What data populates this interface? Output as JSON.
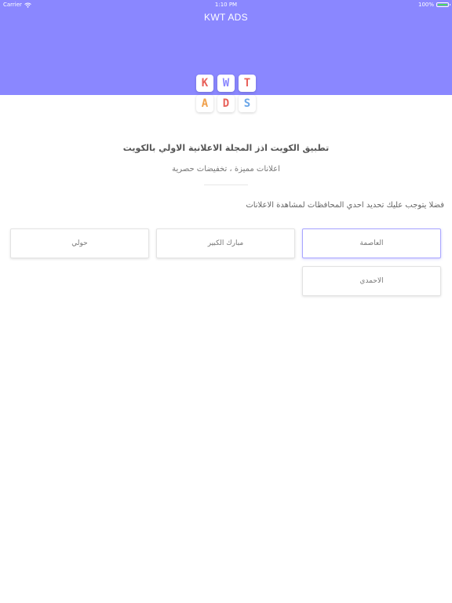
{
  "status_bar": {
    "carrier": "Carrier",
    "time": "1:10 PM",
    "battery": "100%",
    "battery_level": 1.0
  },
  "header": {
    "title": "KWT ADS",
    "color": "#8a87ff"
  },
  "logo": {
    "row1": [
      {
        "letter": "K",
        "color": "#e8615a"
      },
      {
        "letter": "W",
        "color": "#8a87ff"
      },
      {
        "letter": "T",
        "color": "#e8615a"
      }
    ],
    "row2": [
      {
        "letter": "A",
        "color": "#f0a04b"
      },
      {
        "letter": "D",
        "color": "#e8615a"
      },
      {
        "letter": "S",
        "color": "#6aa6e8"
      }
    ]
  },
  "main": {
    "headline": "تطبيق الكويت اذز المجلة الاعلانية الاولي بالكويت",
    "subline": "اعلانات مميزة ، تخفيضات حصرية",
    "instruction": "فضلا يتوجب عليك تحديد احدي المحافظات لمشاهدة الاعلانات"
  },
  "governorates": [
    {
      "label": "العاصمة",
      "selected": true
    },
    {
      "label": "مبارك الكبير",
      "selected": false
    },
    {
      "label": "حولي",
      "selected": false
    },
    {
      "label": "الاحمدي",
      "selected": false
    }
  ]
}
